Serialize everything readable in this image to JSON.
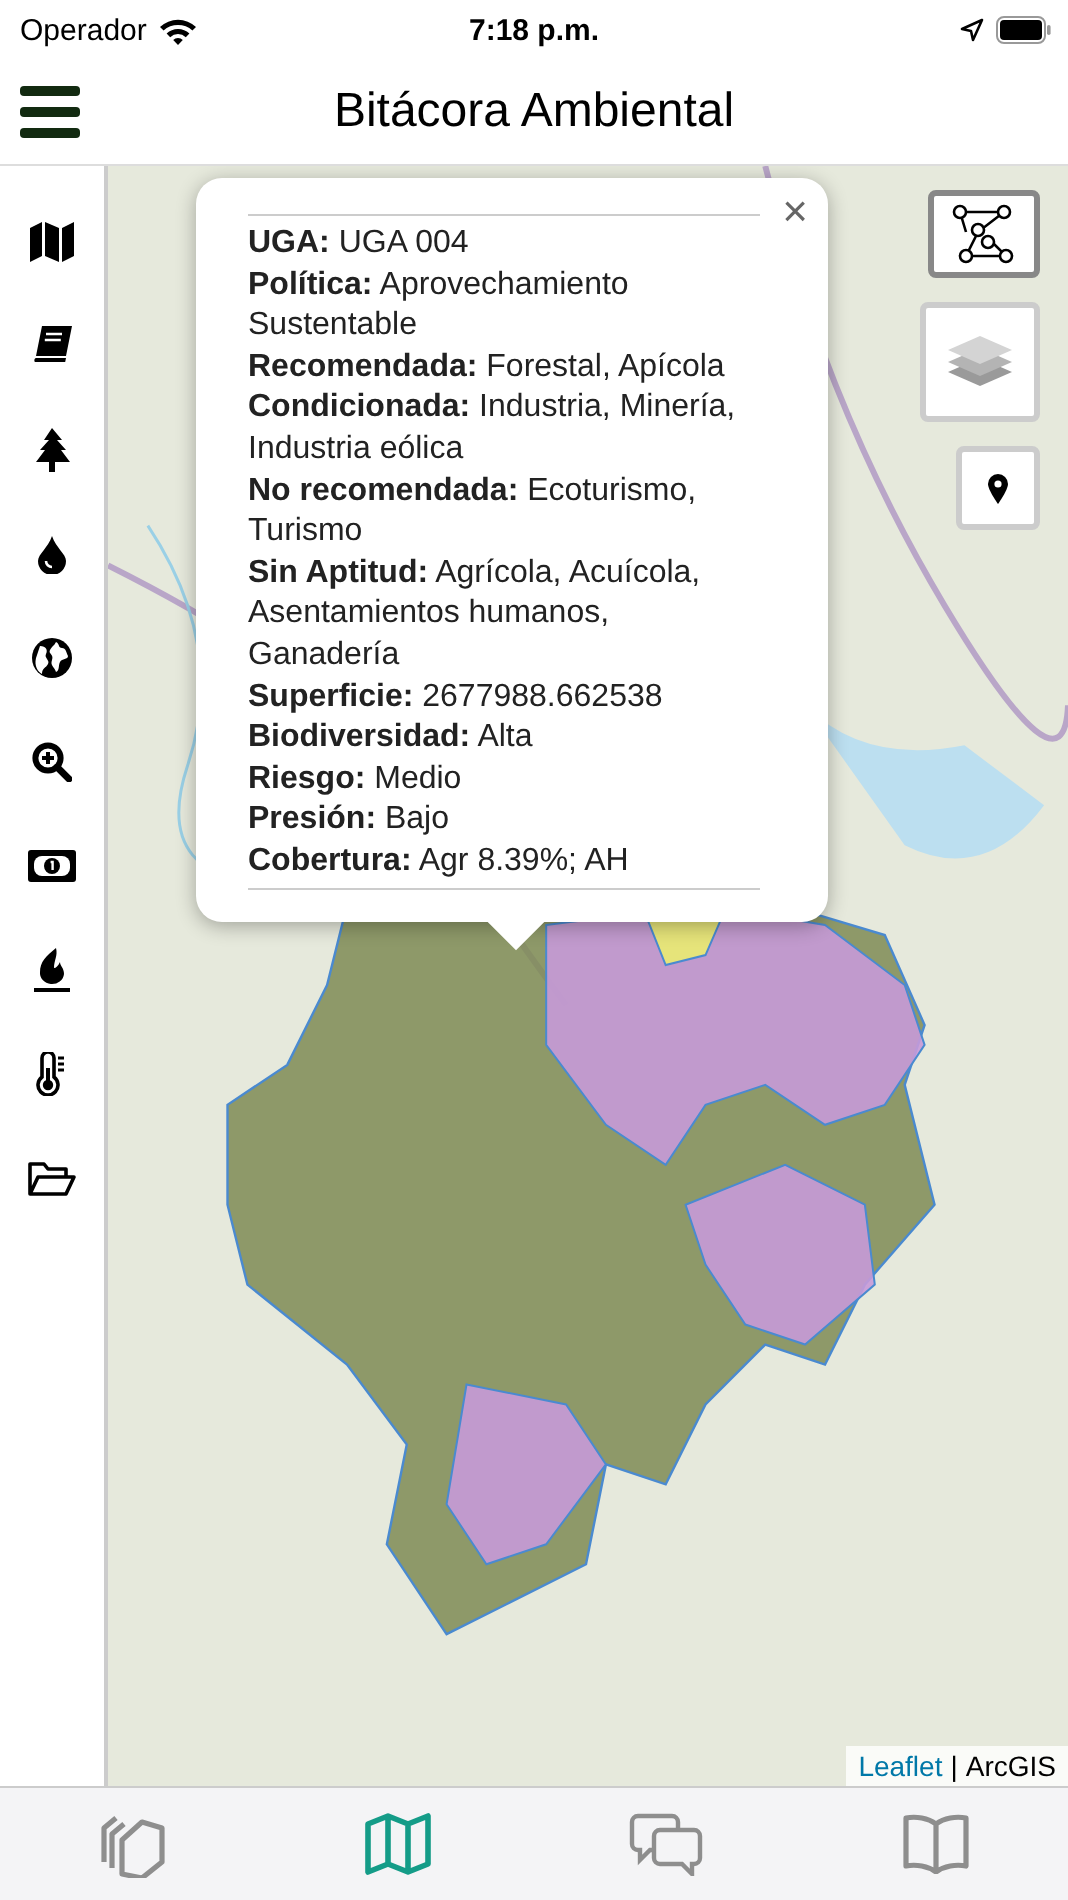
{
  "status_bar": {
    "carrier": "Operador",
    "time": "7:18 p.m."
  },
  "header": {
    "title": "Bitácora Ambiental"
  },
  "sidebar": {
    "items": [
      {
        "kind": "map"
      },
      {
        "kind": "book"
      },
      {
        "kind": "tree"
      },
      {
        "kind": "drop"
      },
      {
        "kind": "globe"
      },
      {
        "kind": "zoom"
      },
      {
        "kind": "money"
      },
      {
        "kind": "fire"
      },
      {
        "kind": "thermometer"
      },
      {
        "kind": "folder"
      }
    ]
  },
  "map": {
    "controls": [
      {
        "kind": "polygon"
      },
      {
        "kind": "layers"
      },
      {
        "kind": "pin"
      }
    ],
    "attribution": {
      "link": "Leaflet",
      "separator": "|",
      "source": "ArcGIS"
    },
    "popup": {
      "fields": [
        "**UGA:** UGA 004",
        "**Política:** Aprovechamiento Sustentable",
        "**Recomendada:** Forestal, Apícola",
        "**Condicionada:** Industria, Minería, Industria eólica",
        "**No recomendada:** Ecoturismo, Turismo",
        "**Sin Aptitud:** Agrícola, Acuícola, Asentamientos humanos, Ganadería",
        "**Superficie:** 2677988.662538",
        "**Biodiversidad:** Alta",
        "**Riesgo:** Medio",
        "**Presión:** Bajo",
        "**Cobertura:** Agr 8.39%; AH"
      ],
      "close": "×"
    }
  },
  "tab_bar": {
    "tabs": [
      {
        "kind": "cards",
        "selected": false
      },
      {
        "kind": "map",
        "selected": true
      },
      {
        "kind": "chat",
        "selected": false
      },
      {
        "kind": "book",
        "selected": false
      }
    ]
  }
}
